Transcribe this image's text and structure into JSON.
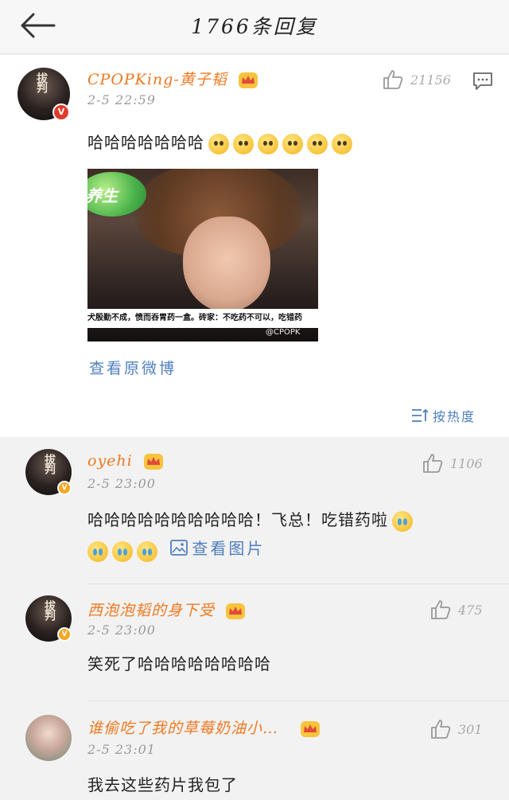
{
  "header": {
    "title": "1766条回复"
  },
  "main": {
    "user": "CPOPKing-黄子韬",
    "time": "2-5 22:59",
    "likes": "21156",
    "text": "哈哈哈哈哈哈哈",
    "caption": "犬殷勤不成，愤而吞胃药一盒。砖家：不吃药不可以，吃错药",
    "watermark": "@CPOPK",
    "logo_text": "养生",
    "view_original": "查看原微博",
    "sort_label": "按热度"
  },
  "comments": [
    {
      "user": "oyehi",
      "time": "2-5 23:00",
      "likes": "1106",
      "text": "哈哈哈哈哈哈哈哈哈哈！飞总！吃错药啦",
      "view_pic": "查看图片"
    },
    {
      "user": "西泡泡韬的身下受",
      "time": "2-5 23:00",
      "likes": "475",
      "text": "笑死了哈哈哈哈哈哈哈哈"
    },
    {
      "user": "谁偷吃了我的草莓奶油小…",
      "time": "2-5 23:01",
      "likes": "301",
      "text": "我去这些药片我包了"
    }
  ],
  "avatar_tag": "拔判",
  "colors": {
    "username": "#f07820",
    "link": "#4f7fbf",
    "background": "#f2f2f2"
  }
}
